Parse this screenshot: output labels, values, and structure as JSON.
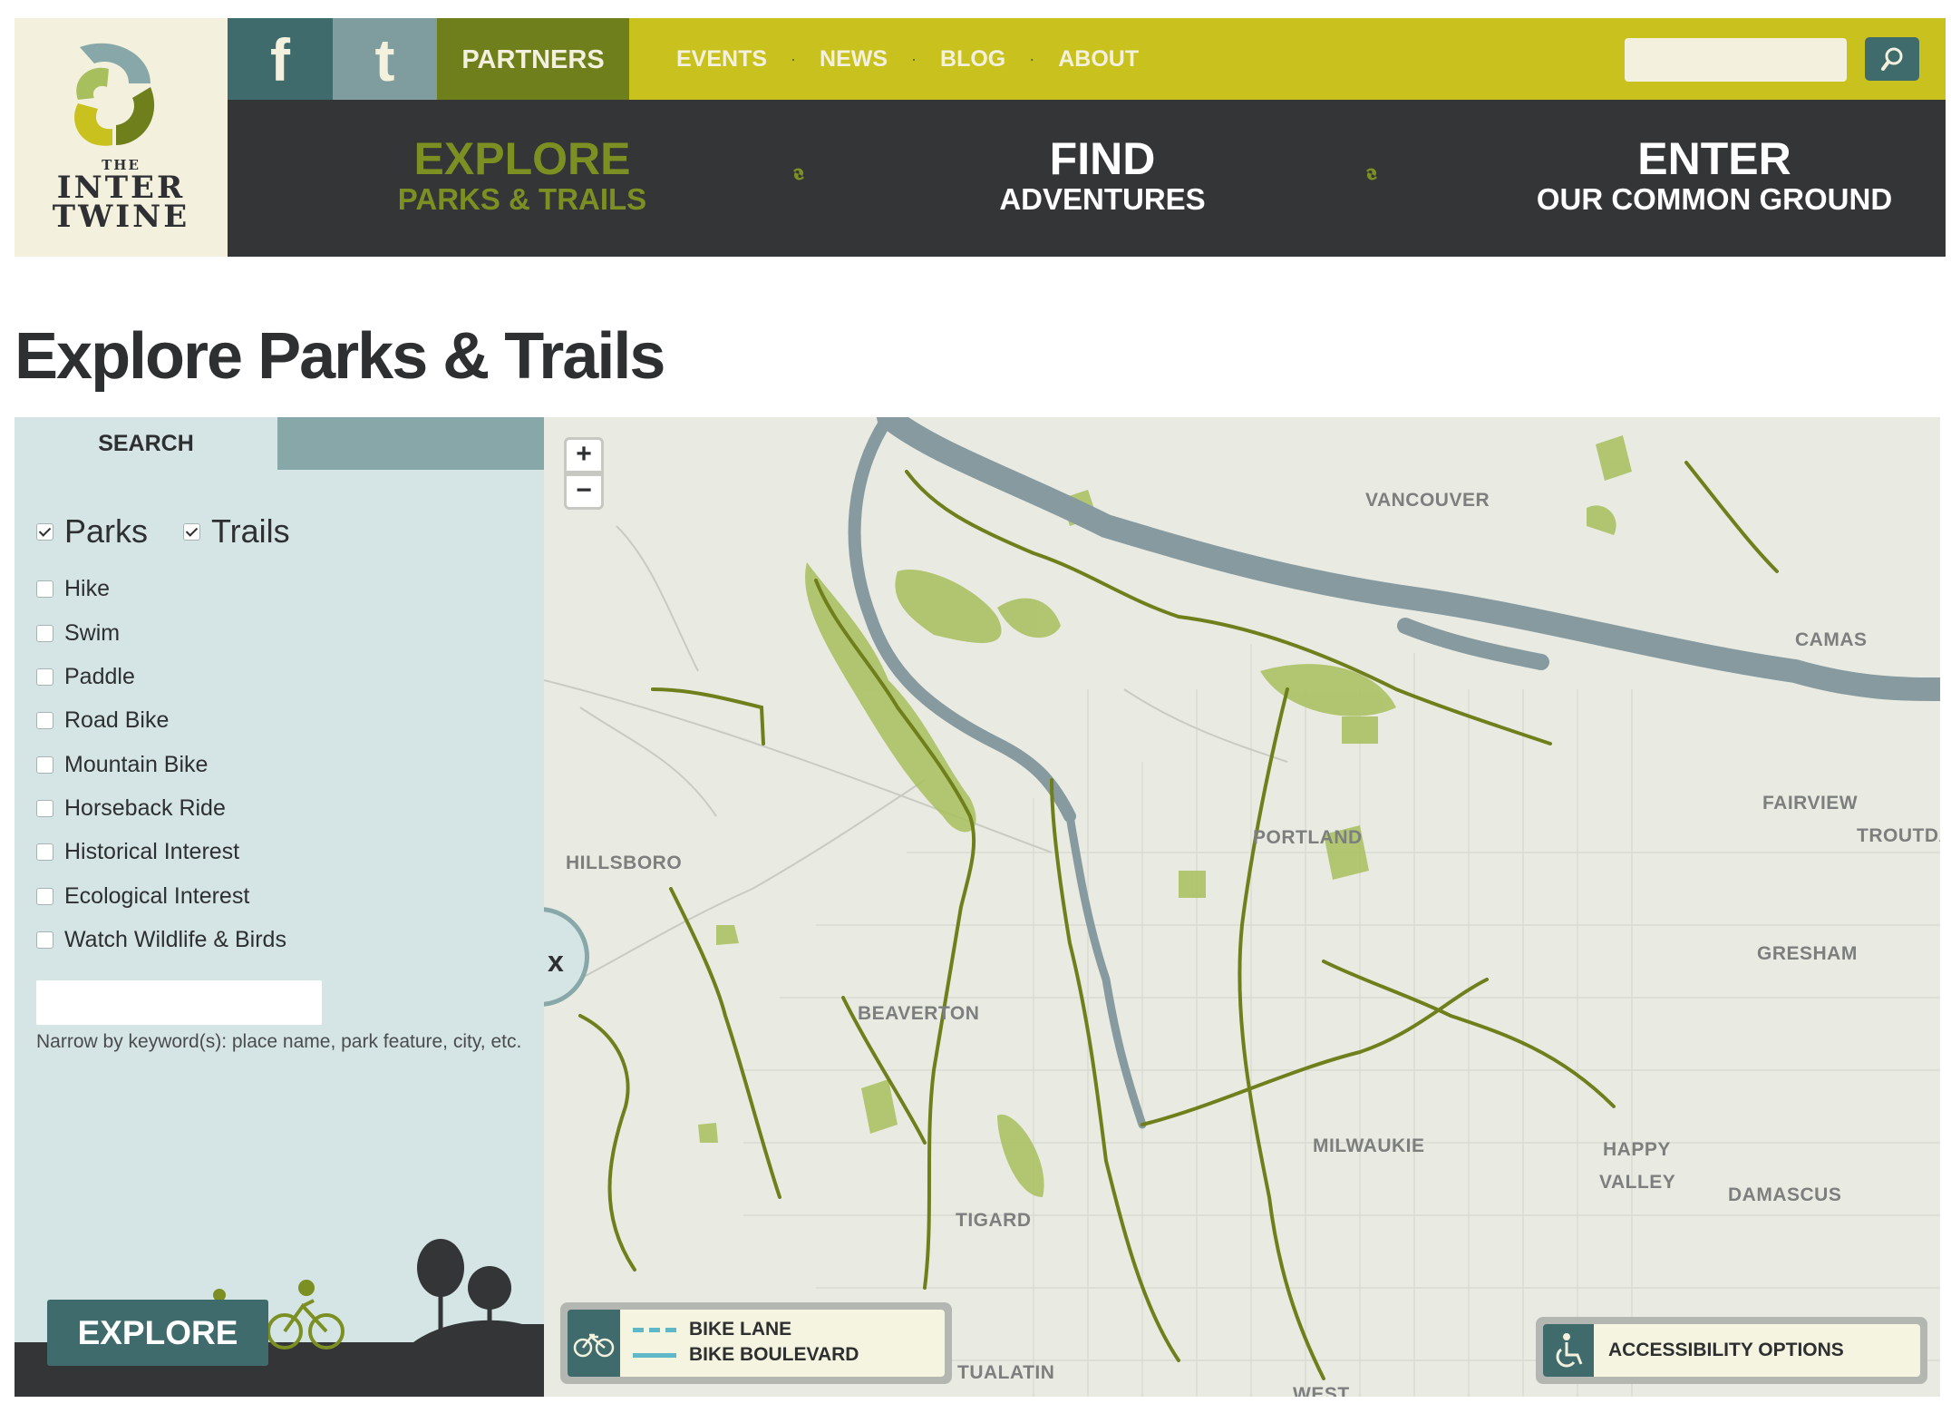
{
  "logo": {
    "the": "THE",
    "line1": "INTER",
    "line2": "TWINE"
  },
  "topbar": {
    "facebook_icon": "f",
    "twitter_icon": "t",
    "partners_label": "PARTNERS",
    "nav": [
      "EVENTS",
      "NEWS",
      "BLOG",
      "ABOUT"
    ],
    "separator": "·",
    "search_placeholder": ""
  },
  "mainnav": {
    "explore": {
      "title": "EXPLORE",
      "sub": "PARKS & TRAILS"
    },
    "find": {
      "title": "FIND",
      "sub": "ADVENTURES"
    },
    "enter": {
      "title": "ENTER",
      "sub": "OUR COMMON GROUND"
    }
  },
  "page": {
    "title": "Explore Parks & Trails"
  },
  "sidebar": {
    "tab_search": "SEARCH",
    "parks_label": "Parks",
    "trails_label": "Trails",
    "filters": [
      "Hike",
      "Swim",
      "Paddle",
      "Road Bike",
      "Mountain Bike",
      "Horseback Ride",
      "Historical Interest",
      "Ecological Interest",
      "Watch Wildlife & Birds"
    ],
    "keyword_value": "",
    "keyword_help": "Narrow by keyword(s): place name, park feature, city, etc.",
    "explore_button": "EXPLORE"
  },
  "map": {
    "zoom_in": "+",
    "zoom_out": "−",
    "collapse": "x",
    "cities": [
      "VANCOUVER",
      "CAMAS",
      "FAIRVIEW",
      "TROUTDALE",
      "PORTLAND",
      "HILLSBORO",
      "GRESHAM",
      "BEAVERTON",
      "MILWAUKIE",
      "HAPPY",
      "VALLEY",
      "DAMASCUS",
      "TIGARD",
      "TUALATIN",
      "WEST"
    ],
    "legend": {
      "bike_lane": "BIKE LANE",
      "bike_boulevard": "BIKE BOULEVARD"
    },
    "accessibility": "ACCESSIBILITY OPTIONS"
  },
  "colors": {
    "olive": "#c8c11e",
    "dark": "#333537",
    "teal": "#3f6b6c",
    "green": "#7b8f22",
    "sidebar": "#d5e5e6",
    "water": "#869aa0",
    "park": "#a8bf5e",
    "trail": "#6f7f1c",
    "bike_lane": "#5fb8c8"
  }
}
